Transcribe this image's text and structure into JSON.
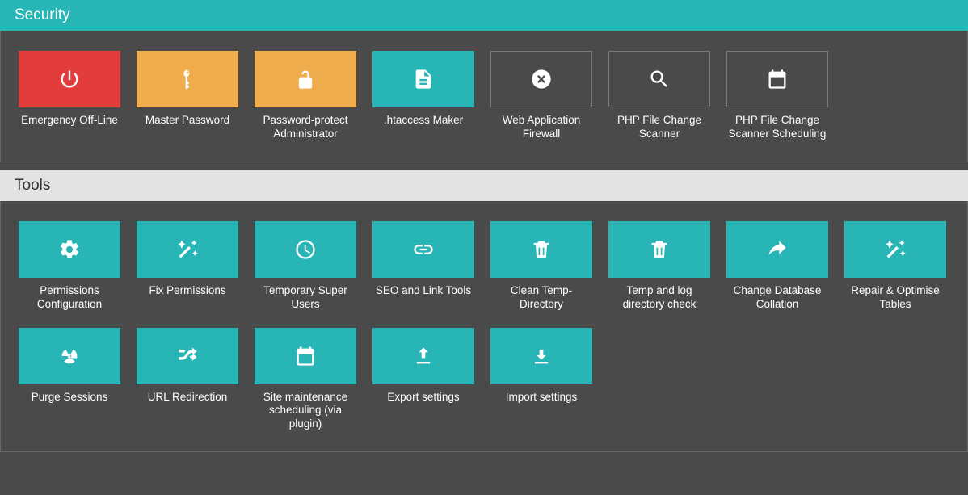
{
  "colors": {
    "teal": "#28b5b5",
    "red": "#e33c3c",
    "orange": "#f0ad4e",
    "dark": "#4a4a4a"
  },
  "panels": {
    "security": {
      "title": "Security",
      "items": [
        {
          "label": "Emergency Off-Line",
          "icon": "power",
          "color": "red"
        },
        {
          "label": "Master Password",
          "icon": "key",
          "color": "orange"
        },
        {
          "label": "Password-protect Administrator",
          "icon": "unlock",
          "color": "orange"
        },
        {
          "label": ".htaccess Maker",
          "icon": "file",
          "color": "teal"
        },
        {
          "label": "Web Application Firewall",
          "icon": "circle-x",
          "color": "dark"
        },
        {
          "label": "PHP File Change Scanner",
          "icon": "search",
          "color": "dark"
        },
        {
          "label": "PHP File Change Scanner Scheduling",
          "icon": "calendar",
          "color": "dark"
        }
      ]
    },
    "tools": {
      "title": "Tools",
      "items": [
        {
          "label": "Permissions Configuration",
          "icon": "gear",
          "color": "teal"
        },
        {
          "label": "Fix Permissions",
          "icon": "wand",
          "color": "teal"
        },
        {
          "label": "Temporary Super Users",
          "icon": "clock",
          "color": "teal"
        },
        {
          "label": "SEO and Link Tools",
          "icon": "link",
          "color": "teal"
        },
        {
          "label": "Clean Temp-Directory",
          "icon": "trash",
          "color": "teal"
        },
        {
          "label": "Temp and log directory check",
          "icon": "trash",
          "color": "teal"
        },
        {
          "label": "Change Database Collation",
          "icon": "share",
          "color": "teal"
        },
        {
          "label": "Repair & Optimise Tables",
          "icon": "wand",
          "color": "teal"
        },
        {
          "label": "Purge Sessions",
          "icon": "radiation",
          "color": "teal"
        },
        {
          "label": "URL Redirection",
          "icon": "shuffle",
          "color": "teal"
        },
        {
          "label": "Site maintenance scheduling (via plugin)",
          "icon": "calendar",
          "color": "teal"
        },
        {
          "label": "Export settings",
          "icon": "export",
          "color": "teal"
        },
        {
          "label": "Import settings",
          "icon": "import",
          "color": "teal"
        }
      ]
    }
  }
}
